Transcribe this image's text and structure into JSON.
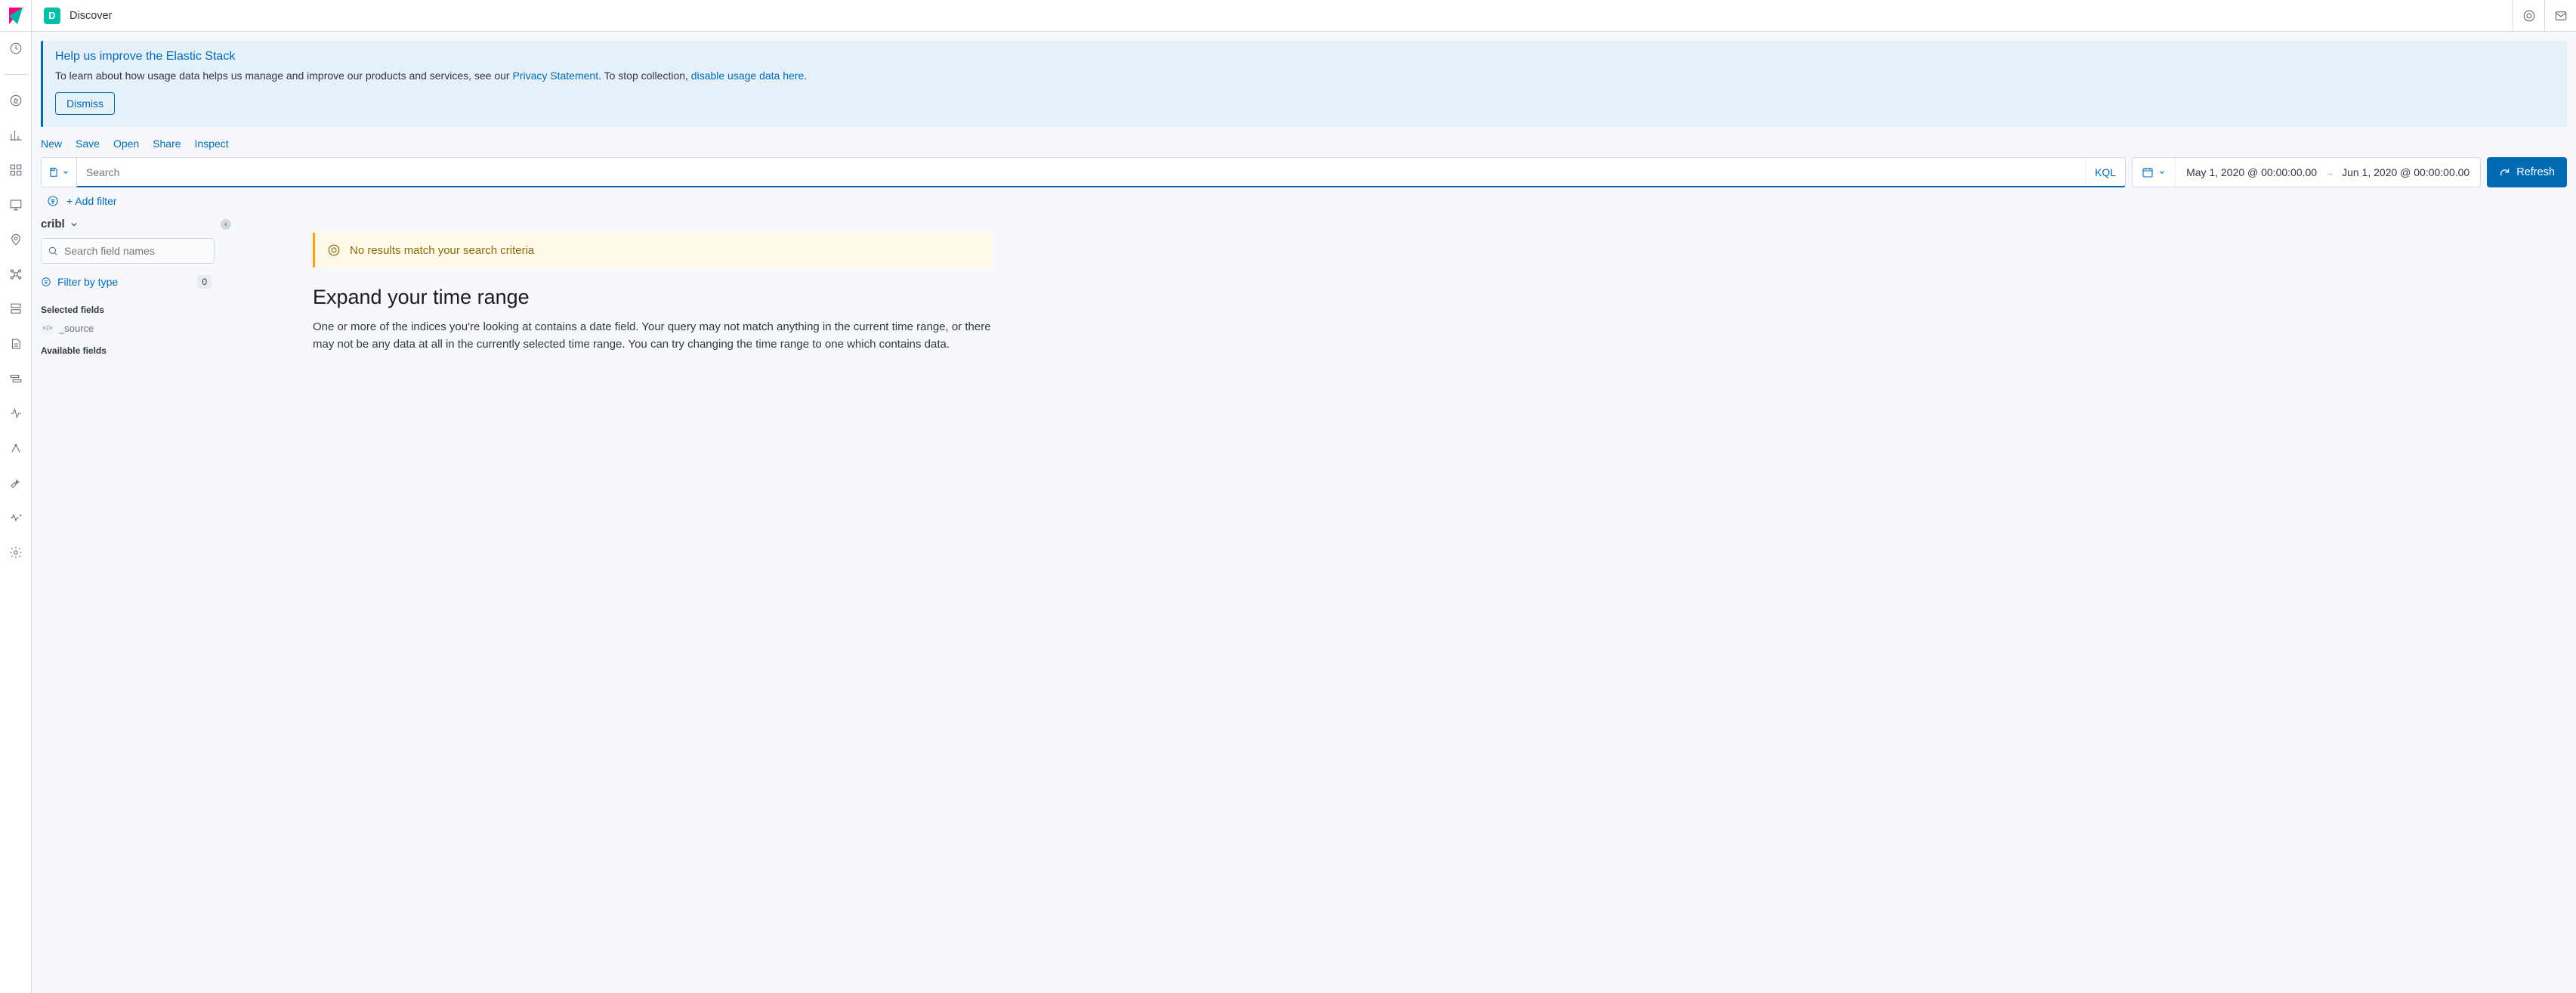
{
  "topbar": {
    "badge_letter": "D",
    "crumb": "Discover"
  },
  "callout": {
    "title": "Help us improve the Elastic Stack",
    "body_pre": "To learn about how usage data helps us manage and improve our products and services, see our ",
    "privacy_link": "Privacy Statement",
    "body_mid": ". To stop collection, ",
    "disable_link": "disable usage data here",
    "body_post": ".",
    "dismiss": "Dismiss"
  },
  "menu": [
    "New",
    "Save",
    "Open",
    "Share",
    "Inspect"
  ],
  "search": {
    "placeholder": "Search",
    "lang": "KQL"
  },
  "time": {
    "from": "May 1, 2020 @ 00:00:00.00",
    "to": "Jun 1, 2020 @ 00:00:00.00"
  },
  "refresh": "Refresh",
  "filter": {
    "add": "+ Add filter"
  },
  "sidebar": {
    "index_pattern": "cribl",
    "field_search_placeholder": "Search field names",
    "filter_by_type": "Filter by type",
    "filter_count": "0",
    "selected_title": "Selected fields",
    "selected_field": "_source",
    "available_title": "Available fields"
  },
  "warn": {
    "text": "No results match your search criteria"
  },
  "content": {
    "h1": "Expand your time range",
    "p": "One or more of the indices you're looking at contains a date field. Your query may not match anything in the current time range, or there may not be any data at all in the currently selected time range. You can try changing the time range to one which contains data."
  }
}
